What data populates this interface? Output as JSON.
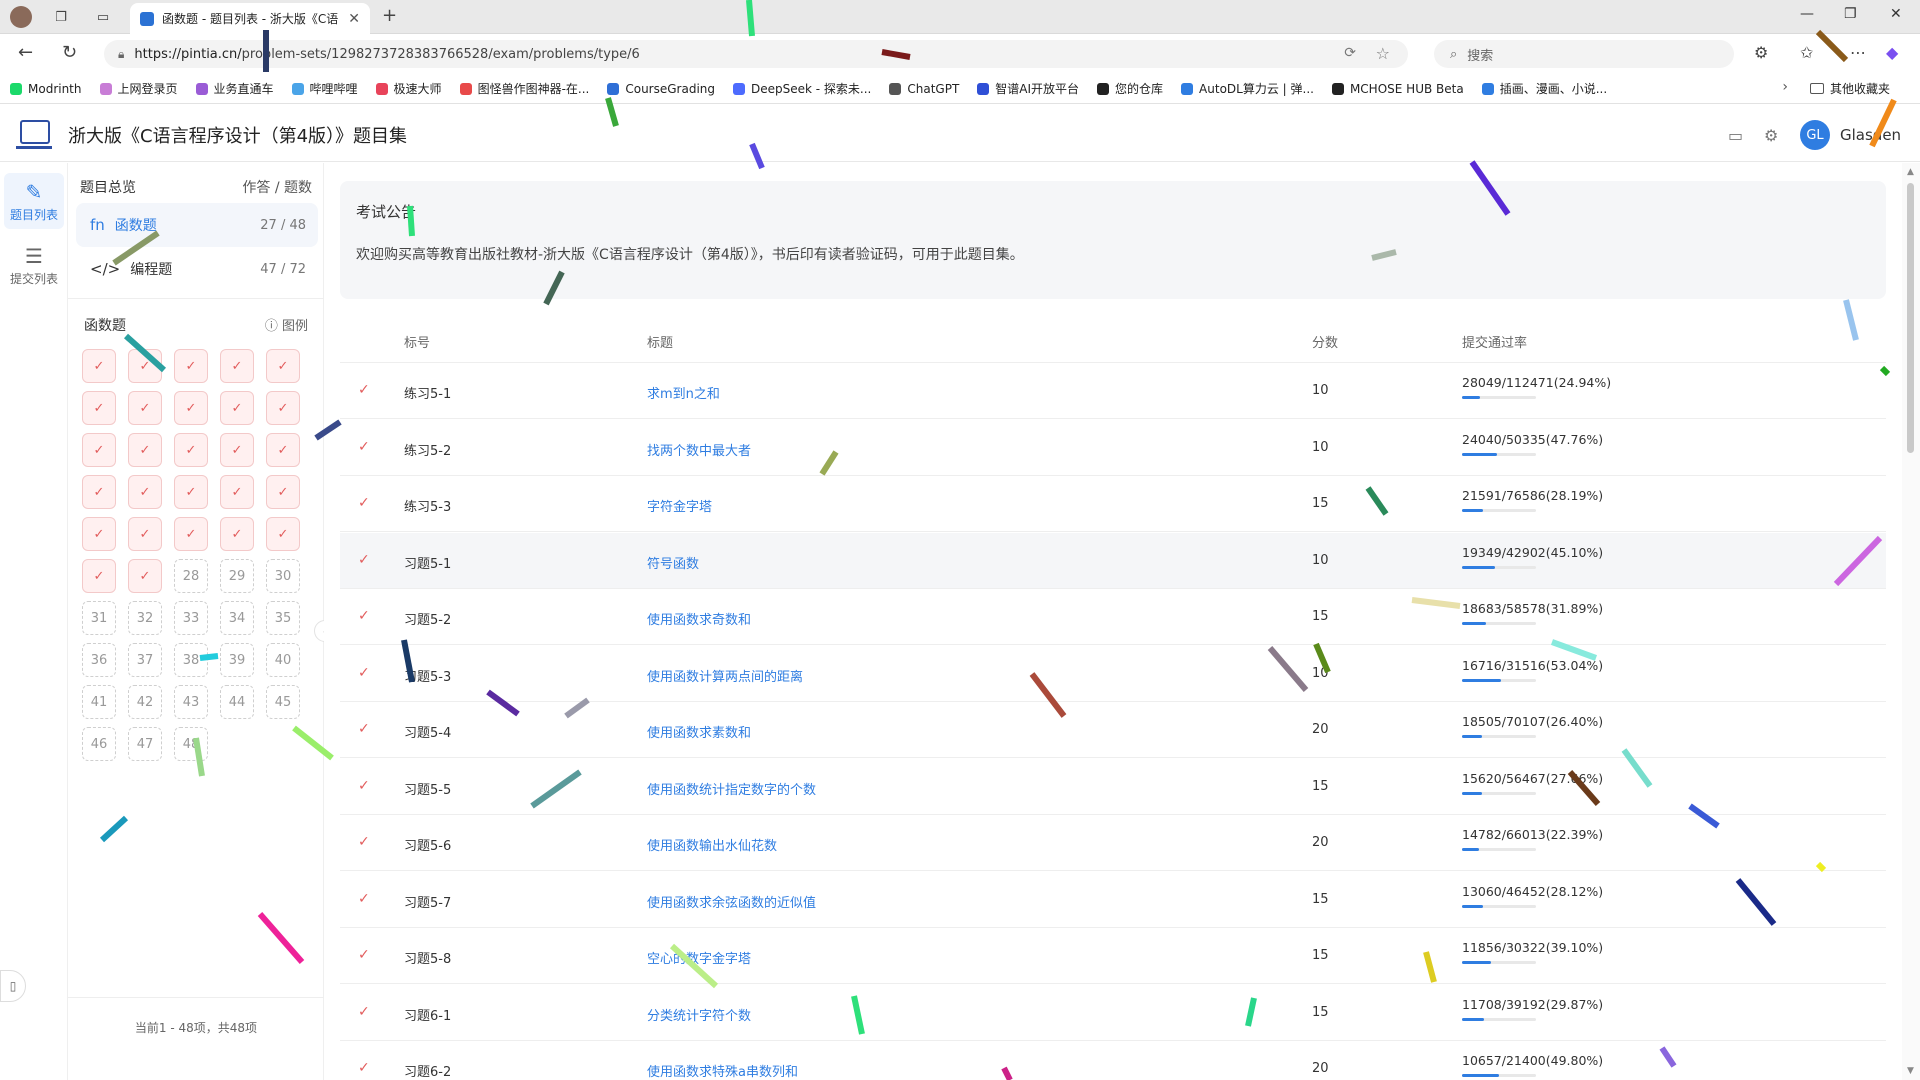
{
  "browser": {
    "tab_title": "函数题 - 题目列表 - 浙大版《C语",
    "url_host": "https://pintia.cn/",
    "url_path": "problem-sets/1298273728383766528/exam/problems/type/6",
    "search_placeholder": "搜索",
    "bookmarks": [
      {
        "label": "Modrinth",
        "color": "#1bd96a"
      },
      {
        "label": "上网登录页",
        "color": "#c87dd6"
      },
      {
        "label": "业务直通车",
        "color": "#9a5cd6"
      },
      {
        "label": "哔哩哔哩",
        "color": "#4aa4e8"
      },
      {
        "label": "极速大师",
        "color": "#e8435a"
      },
      {
        "label": "图怪兽作图神器-在...",
        "color": "#e84a4a"
      },
      {
        "label": "CourseGrading",
        "color": "#2f6fd6"
      },
      {
        "label": "DeepSeek - 探索未...",
        "color": "#4d6bfe"
      },
      {
        "label": "ChatGPT",
        "color": "#555555"
      },
      {
        "label": "智谱AI开放平台",
        "color": "#2f4fd6"
      },
      {
        "label": "您的仓库",
        "color": "#222222"
      },
      {
        "label": "AutoDL算力云 | 弹...",
        "color": "#2f7de1"
      },
      {
        "label": "MCHOSE HUB Beta",
        "color": "#222222"
      },
      {
        "label": "插画、漫画、小说...",
        "color": "#2f7de1"
      }
    ],
    "other_bookmarks": "其他收藏夹"
  },
  "app": {
    "title": "浙大版《C语言程序设计（第4版）》题目集",
    "user_initials": "GL",
    "user_name": "Glasden"
  },
  "rail": {
    "items": [
      {
        "label": "题目列表",
        "icon": "edit-list-icon",
        "active": true
      },
      {
        "label": "提交列表",
        "icon": "list-icon",
        "active": false
      }
    ]
  },
  "panel": {
    "overview_label": "题目总览",
    "overview_right": "作答 / 题数",
    "types": [
      {
        "label": "函数题",
        "count": "27 / 48",
        "icon": "fn",
        "active": true
      },
      {
        "label": "编程题",
        "count": "47 / 72",
        "icon": "</>",
        "active": false
      }
    ],
    "grid_title": "函数题",
    "legend": "图例",
    "cells": [
      "✓",
      "✓",
      "✓",
      "✓",
      "✓",
      "✓",
      "✓",
      "✓",
      "✓",
      "✓",
      "✓",
      "✓",
      "✓",
      "✓",
      "✓",
      "✓",
      "✓",
      "✓",
      "✓",
      "✓",
      "✓",
      "✓",
      "✓",
      "✓",
      "✓",
      "✓",
      "✓",
      "28",
      "29",
      "30",
      "31",
      "32",
      "33",
      "34",
      "35",
      "36",
      "37",
      "38",
      "39",
      "40",
      "41",
      "42",
      "43",
      "44",
      "45",
      "46",
      "47",
      "48"
    ],
    "cells_done": 27,
    "pager": "当前1 - 48项，共48项"
  },
  "notice": {
    "title": "考试公告",
    "body": "欢迎购买高等教育出版社教材-浙大版《C语言程序设计（第4版）》，书后印有读者验证码，可用于此题目集。"
  },
  "table": {
    "headers": [
      "标号",
      "标题",
      "分数",
      "提交通过率"
    ],
    "rows": [
      {
        "label": "练习5-1",
        "title": "求m到n之和",
        "score": "10",
        "rate": "28049/112471(24.94%)",
        "pct": 24.94
      },
      {
        "label": "练习5-2",
        "title": "找两个数中最大者",
        "score": "10",
        "rate": "24040/50335(47.76%)",
        "pct": 47.76
      },
      {
        "label": "练习5-3",
        "title": "字符金字塔",
        "score": "15",
        "rate": "21591/76586(28.19%)",
        "pct": 28.19
      },
      {
        "label": "习题5-1",
        "title": "符号函数",
        "score": "10",
        "rate": "19349/42902(45.10%)",
        "pct": 45.1
      },
      {
        "label": "习题5-2",
        "title": "使用函数求奇数和",
        "score": "15",
        "rate": "18683/58578(31.89%)",
        "pct": 31.89
      },
      {
        "label": "习题5-3",
        "title": "使用函数计算两点间的距离",
        "score": "10",
        "rate": "16716/31516(53.04%)",
        "pct": 53.04
      },
      {
        "label": "习题5-4",
        "title": "使用函数求素数和",
        "score": "20",
        "rate": "18505/70107(26.40%)",
        "pct": 26.4
      },
      {
        "label": "习题5-5",
        "title": "使用函数统计指定数字的个数",
        "score": "15",
        "rate": "15620/56467(27.66%)",
        "pct": 27.66
      },
      {
        "label": "习题5-6",
        "title": "使用函数输出水仙花数",
        "score": "20",
        "rate": "14782/66013(22.39%)",
        "pct": 22.39
      },
      {
        "label": "习题5-7",
        "title": "使用函数求余弦函数的近似值",
        "score": "15",
        "rate": "13060/46452(28.12%)",
        "pct": 28.12
      },
      {
        "label": "习题5-8",
        "title": "空心的数字金字塔",
        "score": "15",
        "rate": "11856/30322(39.10%)",
        "pct": 39.1
      },
      {
        "label": "习题6-1",
        "title": "分类统计字符个数",
        "score": "15",
        "rate": "11708/39192(29.87%)",
        "pct": 29.87
      },
      {
        "label": "习题6-2",
        "title": "使用函数求特殊a串数列和",
        "score": "20",
        "rate": "10657/21400(49.80%)",
        "pct": 49.8
      }
    ]
  }
}
